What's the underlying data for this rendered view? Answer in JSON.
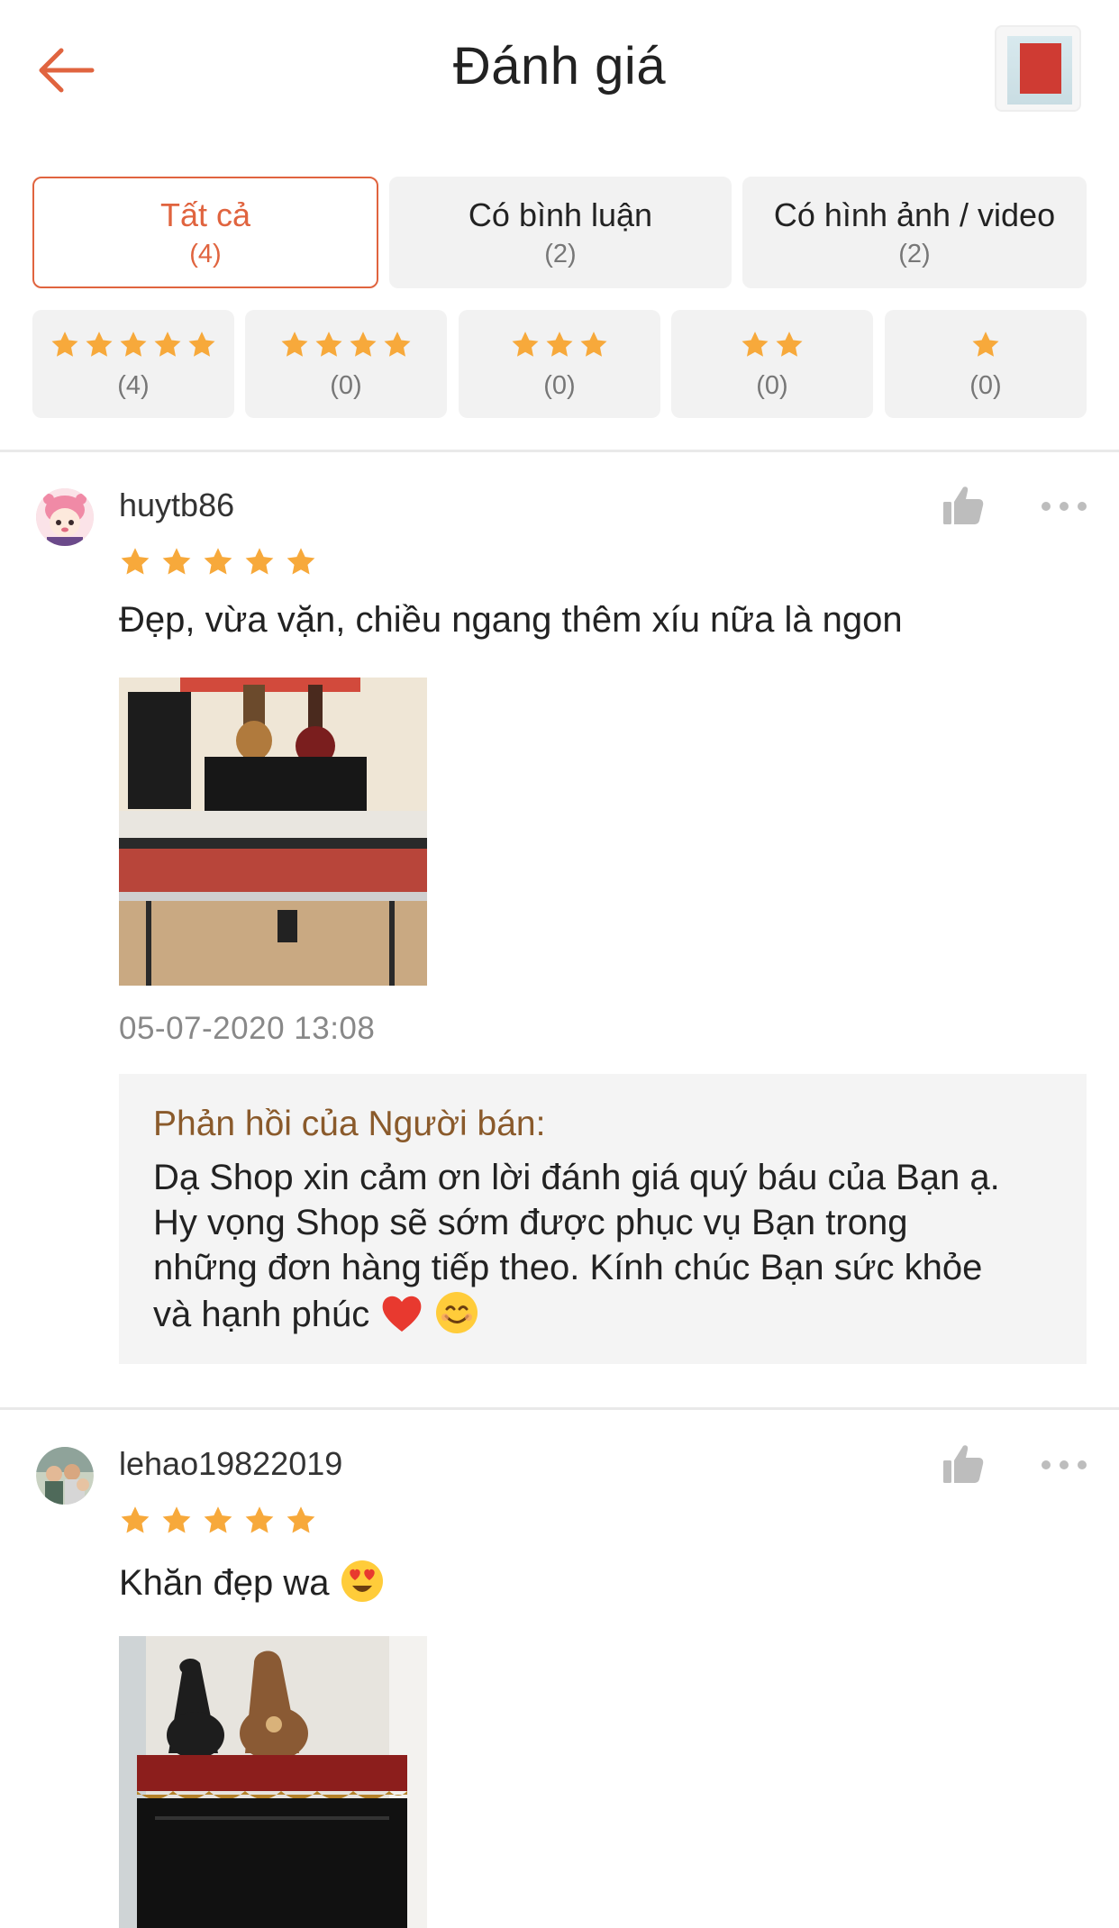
{
  "header": {
    "title": "Đánh giá"
  },
  "filters": {
    "tabs": [
      {
        "label": "Tất cả",
        "count": "(4)"
      },
      {
        "label": "Có bình luận",
        "count": "(2)"
      },
      {
        "label": "Có hình ảnh / video",
        "count": "(2)"
      }
    ],
    "star_filters": [
      {
        "stars": 5,
        "count": "(4)"
      },
      {
        "stars": 4,
        "count": "(0)"
      },
      {
        "stars": 3,
        "count": "(0)"
      },
      {
        "stars": 2,
        "count": "(0)"
      },
      {
        "stars": 1,
        "count": "(0)"
      }
    ]
  },
  "reviews": [
    {
      "username": "huytb86",
      "rating": 5,
      "text": "Đẹp, vừa vặn, chiều ngang thêm xíu nữa là ngon",
      "timestamp": "05-07-2020 13:08",
      "seller_reply": {
        "title": "Phản hồi của Người bán:",
        "line1": "Dạ Shop xin cảm ơn lời đánh giá quý báu của Bạn ạ.",
        "line2": "Hy vọng Shop sẽ sớm được phục vụ Bạn trong",
        "line3": "những đơn hàng tiếp theo. Kính chúc Bạn sức khỏe",
        "line4": "và hạnh phúc"
      }
    },
    {
      "username": "lehao19822019",
      "rating": 5,
      "text": "Khăn đẹp wa"
    }
  ],
  "colors": {
    "accent": "#e0643f",
    "star": "#f7a93b",
    "seller_title": "#8a5a2b"
  },
  "icons": [
    "back-arrow-icon",
    "star-icon",
    "thumbs-up-icon",
    "more-icon",
    "heart-emoji-icon",
    "smile-emoji-icon",
    "heart-eyes-emoji-icon"
  ]
}
